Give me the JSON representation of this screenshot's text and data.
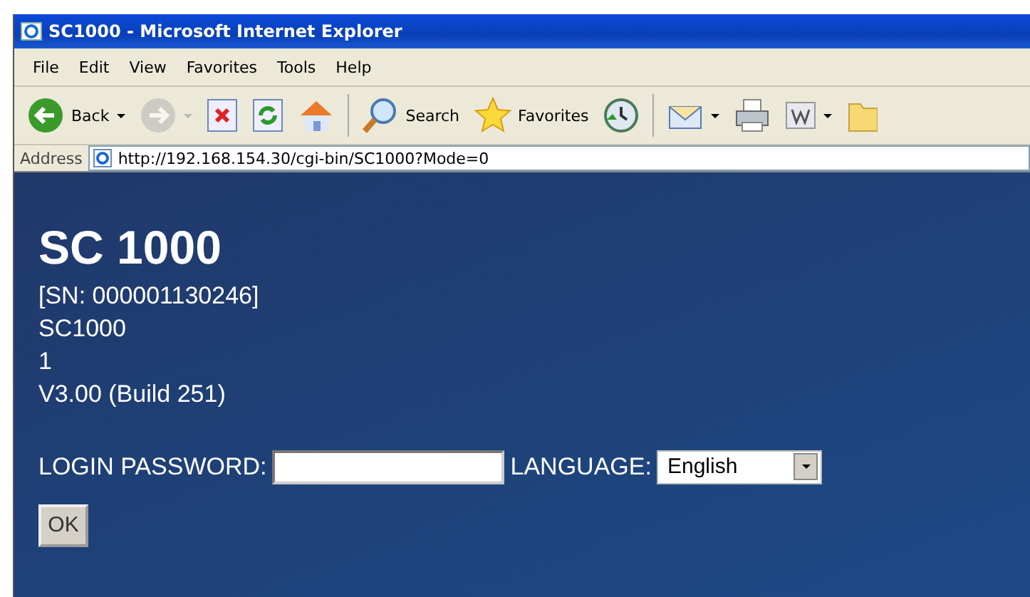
{
  "window": {
    "title": "SC1000 - Microsoft Internet Explorer"
  },
  "menu": [
    "File",
    "Edit",
    "View",
    "Favorites",
    "Tools",
    "Help"
  ],
  "toolbar": [
    {
      "kind": "back",
      "label": "Back",
      "dropdown": true,
      "disabled": false
    },
    {
      "kind": "forward",
      "dropdown": true,
      "disabled": true
    },
    {
      "kind": "stop",
      "dropdown": false,
      "disabled": false
    },
    {
      "kind": "refresh",
      "dropdown": false,
      "disabled": false
    },
    {
      "kind": "home",
      "dropdown": false,
      "disabled": false
    },
    {
      "kind": "separator"
    },
    {
      "kind": "search",
      "label": "Search",
      "dropdown": false,
      "disabled": false
    },
    {
      "kind": "favorites",
      "label": "Favorites",
      "dropdown": false,
      "disabled": false
    },
    {
      "kind": "history",
      "dropdown": false,
      "disabled": false
    },
    {
      "kind": "separator"
    },
    {
      "kind": "mail",
      "dropdown": true,
      "disabled": false
    },
    {
      "kind": "print",
      "dropdown": false,
      "disabled": false
    },
    {
      "kind": "word",
      "dropdown": true,
      "disabled": false
    },
    {
      "kind": "folder",
      "dropdown": false,
      "disabled": false
    }
  ],
  "address": {
    "label": "Address",
    "url": "http://192.168.154.30/cgi-bin/SC1000?Mode=0"
  },
  "page": {
    "heading": "SC 1000",
    "info_lines": [
      "[SN: 000001130246]",
      "SC1000",
      "1",
      "V3.00 (Build 251)"
    ],
    "password_label": "LOGIN PASSWORD:",
    "language_label": "LANGUAGE:",
    "language_value": "English",
    "ok_button": "OK"
  }
}
